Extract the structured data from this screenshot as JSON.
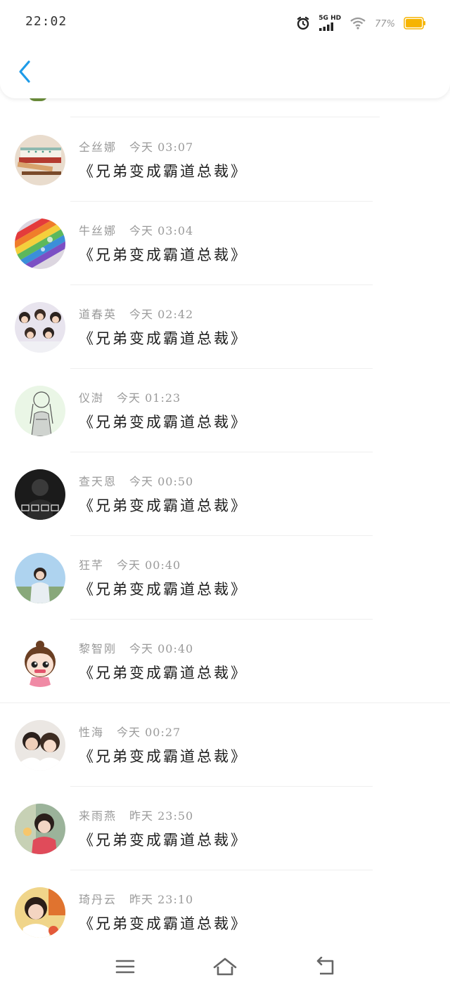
{
  "status_bar": {
    "time": "22:02",
    "network": "5G HD",
    "battery": "77%",
    "battery_color": "#f6b400"
  },
  "header": {
    "back_icon": "chevron-left-icon",
    "accent_color": "#1e9be8"
  },
  "items": [
    {
      "name": "仝丝娜",
      "time": "今天 03:07",
      "title": "《兄弟变成霸道总裁》",
      "avatar": "books"
    },
    {
      "name": "牛丝娜",
      "time": "今天 03:04",
      "title": "《兄弟变成霸道总裁》",
      "avatar": "rainbow"
    },
    {
      "name": "道春英",
      "time": "今天 02:42",
      "title": "《兄弟变成霸道总裁》",
      "avatar": "group"
    },
    {
      "name": "仪澍",
      "time": "今天 01:23",
      "title": "《兄弟变成霸道总裁》",
      "avatar": "sketch-girl"
    },
    {
      "name": "查天恩",
      "time": "今天 00:50",
      "title": "《兄弟变成霸道总裁》",
      "avatar": "dark-portrait"
    },
    {
      "name": "狂芊",
      "time": "今天 00:40",
      "title": "《兄弟变成霸道总裁》",
      "avatar": "sky-girl"
    },
    {
      "name": "黎智刚",
      "time": "今天 00:40",
      "title": "《兄弟变成霸道总裁》",
      "avatar": "cartoon-girl"
    },
    {
      "name": "性海",
      "time": "今天 00:27",
      "title": "《兄弟变成霸道总裁》",
      "avatar": "couple"
    },
    {
      "name": "来雨燕",
      "time": "昨天 23:50",
      "title": "《兄弟变成霸道总裁》",
      "avatar": "girl-photo"
    },
    {
      "name": "琦丹云",
      "time": "昨天 23:10",
      "title": "《兄弟变成霸道总裁》",
      "avatar": "child"
    }
  ],
  "nav": {
    "menu_icon": "menu-icon",
    "home_icon": "home-icon",
    "back_icon": "return-icon"
  }
}
